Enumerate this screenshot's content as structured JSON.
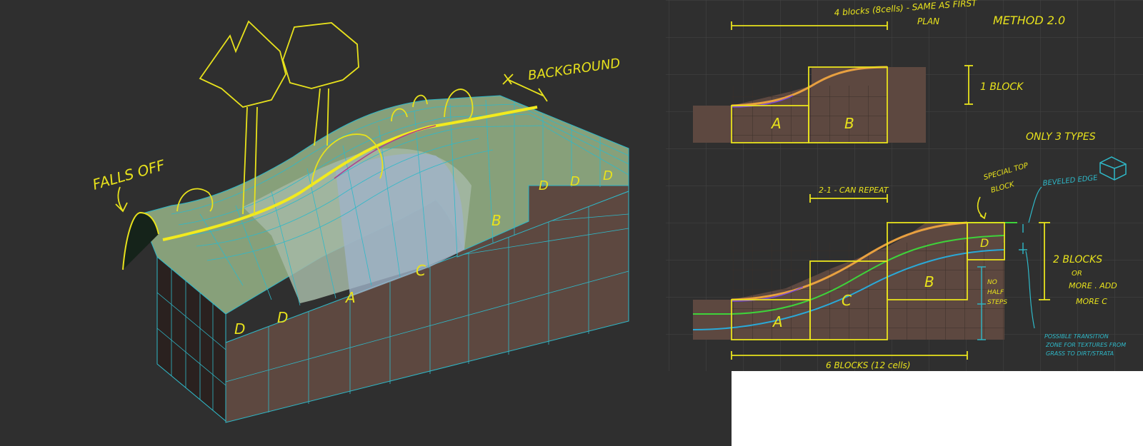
{
  "left_sketch": {
    "labels": {
      "falls_off": "FALLS OFF",
      "background": "BACKGROUND",
      "block_a": "A",
      "block_b": "B",
      "block_c": "C",
      "block_d": "D"
    }
  },
  "right_sketch": {
    "title": "METHOD 2.0",
    "top_note_line1": "4 blocks (8cells) - SAME AS FIRST",
    "top_note_line2": "PLAN",
    "one_block": "1 BLOCK",
    "only_types": "ONLY 3 TYPES",
    "repeat_note": "2-1 - CAN REPEAT",
    "special_top_line1": "SPECIAL TOP",
    "special_top_line2": "BLOCK",
    "beveled_edge": "BEVELED EDGE",
    "two_blocks_line1": "2 BLOCKS",
    "two_blocks_line2": "OR",
    "two_blocks_line3": "MORE . ADD",
    "two_blocks_line4": "MORE C",
    "no_half_line1": "NO",
    "no_half_line2": "HALF",
    "no_half_line3": "STEPS",
    "transition_line1": "POSSIBLE TRANSITION",
    "transition_line2": "ZONE FOR TEXTURES FROM",
    "transition_line3": "GRASS TO DIRT/STRATA",
    "bottom_note": "6 BLOCKS (12 cells)",
    "block_a": "A",
    "block_b": "B",
    "block_c": "C",
    "block_d": "D"
  },
  "colors": {
    "background": "#2f2f2f",
    "sketch_yellow": "#e8e21c",
    "grid_cyan": "#2fb9c9",
    "dirt": "#5d4840",
    "grass": "#7d9470",
    "cyan_line": "#2aa9d8",
    "green_line": "#3ed33a"
  }
}
